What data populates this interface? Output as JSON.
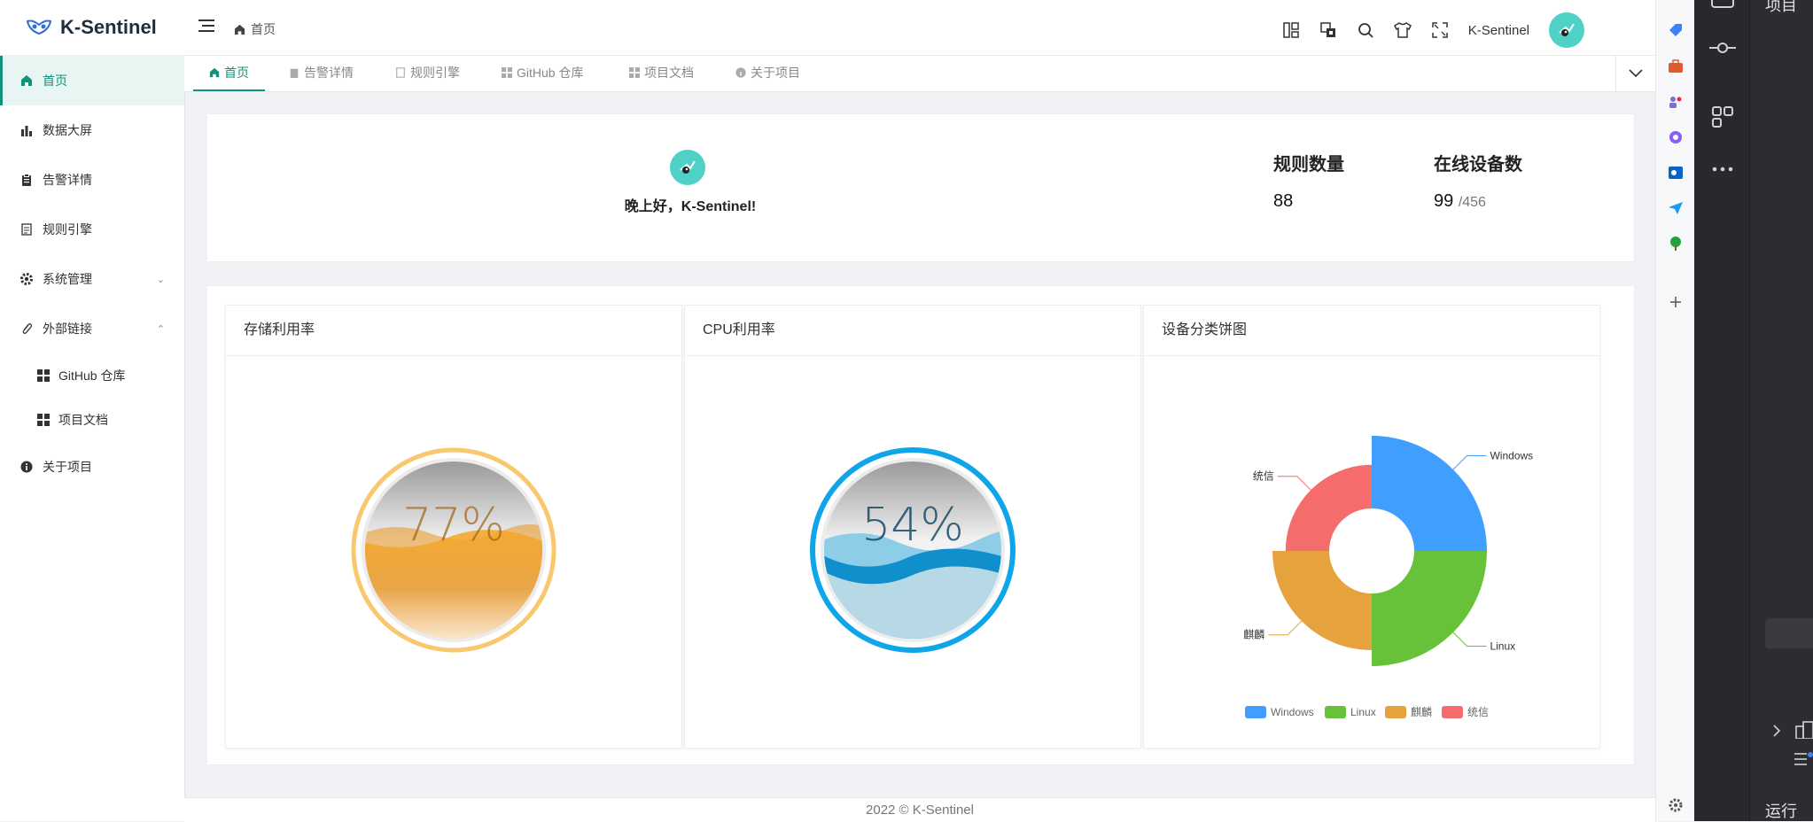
{
  "app": {
    "name": "K-Sentinel"
  },
  "sidebar": {
    "items": [
      {
        "label": "首页",
        "icon": "home-icon",
        "active": true
      },
      {
        "label": "数据大屏",
        "icon": "bar-chart-icon"
      },
      {
        "label": "告警详情",
        "icon": "clipboard-icon"
      },
      {
        "label": "规则引擎",
        "icon": "document-icon"
      },
      {
        "label": "系统管理",
        "icon": "gear-icon",
        "expandable": true
      },
      {
        "label": "外部链接",
        "icon": "paperclip-icon",
        "expandable": true,
        "expanded": true
      }
    ],
    "subitems": [
      {
        "label": "GitHub 仓库",
        "icon": "grid-icon"
      },
      {
        "label": "项目文档",
        "icon": "grid-icon"
      }
    ],
    "about": {
      "label": "关于项目",
      "icon": "info-icon"
    }
  },
  "header": {
    "breadcrumb": "首页",
    "username": "K-Sentinel",
    "icons": [
      "layout-icon",
      "translate-icon",
      "search-icon",
      "theme-shirt-icon",
      "fullscreen-icon"
    ]
  },
  "tabs": [
    {
      "label": "首页",
      "active": true
    },
    {
      "label": "告警详情"
    },
    {
      "label": "规则引擎"
    },
    {
      "label": "GitHub 仓库"
    },
    {
      "label": "项目文档"
    },
    {
      "label": "关于项目"
    }
  ],
  "welcome": {
    "greeting": "晚上好，K-Sentinel!",
    "rules_title": "规则数量",
    "rules_value": "88",
    "devices_title": "在线设备数",
    "devices_online": "99",
    "devices_total": "/456"
  },
  "panels": {
    "storage": {
      "title": "存储利用率",
      "value_label": "77%",
      "value": 0.77,
      "color": "#f5a623"
    },
    "cpu": {
      "title": "CPU利用率",
      "value_label": "54%",
      "value": 0.54,
      "color": "#0ea5e9"
    },
    "pie": {
      "title": "设备分类饼图"
    }
  },
  "chart_data": {
    "type": "pie",
    "subtype": "nightingale-rose",
    "title": "设备分类饼图",
    "categories": [
      "Windows",
      "Linux",
      "麒麟",
      "统信"
    ],
    "values": [
      25,
      25,
      25,
      25
    ],
    "radius_ratio": [
      1.0,
      1.0,
      0.78,
      0.6
    ],
    "colors": [
      "#409eff",
      "#67c23a",
      "#e6a23c",
      "#f56c6c"
    ],
    "legend": "bottom-center"
  },
  "footer": {
    "text": "2022 © K-Sentinel"
  },
  "ide": {
    "top_label": "项目",
    "bottom_label": "运行"
  }
}
